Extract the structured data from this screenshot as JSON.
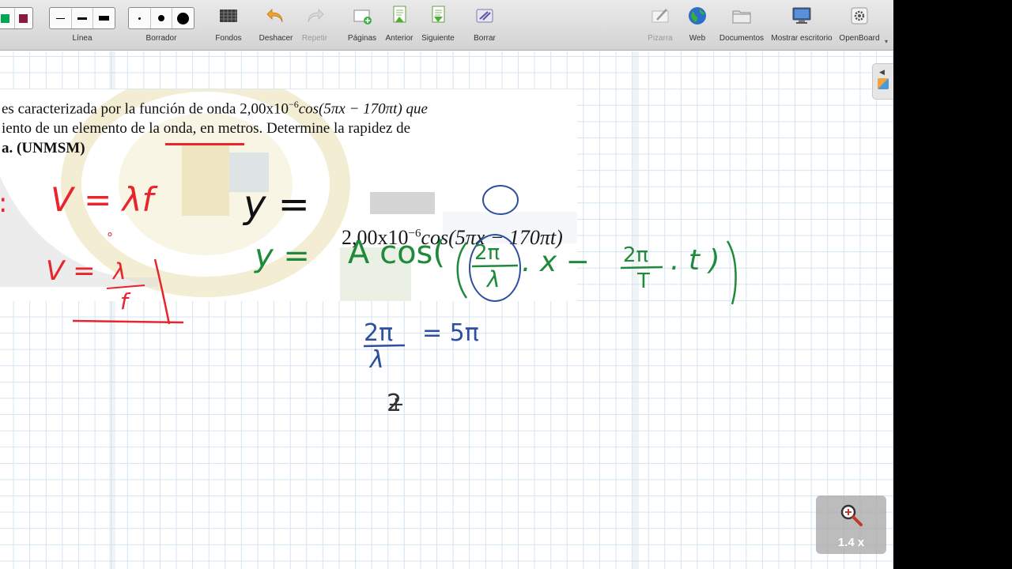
{
  "toolbar": {
    "line_label": "Línea",
    "eraser_label": "Borrador",
    "backgrounds_label": "Fondos",
    "undo_label": "Deshacer",
    "redo_label": "Repetir",
    "pages_label": "Páginas",
    "previous_label": "Anterior",
    "next_label": "Siguiente",
    "clear_label": "Borrar",
    "board_label": "Pizarra",
    "web_label": "Web",
    "documents_label": "Documentos",
    "desktop_label": "Mostrar escritorio",
    "openboard_label": "OpenBoard",
    "colors": [
      "#00a651",
      "#8b1a3d"
    ]
  },
  "problem": {
    "line1_a": "es caracterizada por la función de onda 2,00x10",
    "line1_sup": "−6",
    "line1_b": "cos(5πx − 170πt) que",
    "line2": "iento de un elemento de la onda, en metros. Determine la rapidez de",
    "line3": "a. (UNMSM)"
  },
  "printed_equation": {
    "main": "2,00x10",
    "sup": "−6",
    "rest": "cos(5πx − 170πt)"
  },
  "handwriting": {
    "red_v_formula": "V = λf",
    "red_v_num": "λ",
    "red_v_den": "f",
    "red_v_lhs": "V =",
    "black_y_eq": "y =",
    "green_y_eq": "y =",
    "green_a_cos": "A cos(",
    "green_2pi_1": "2π",
    "green_lambda": "λ",
    "green_x": ". x −",
    "green_2pi_2": "2π",
    "green_t_den": "T",
    "green_t": ". t )",
    "blue_2pi": "2π",
    "blue_lambda": "λ",
    "blue_eq": "= 5π",
    "blue_digits": "2"
  },
  "zoom": {
    "label": "1.4 x"
  },
  "accent_colors": {
    "red": "#e8242c",
    "green": "#1f8a3a",
    "blue": "#2d4f9e"
  }
}
